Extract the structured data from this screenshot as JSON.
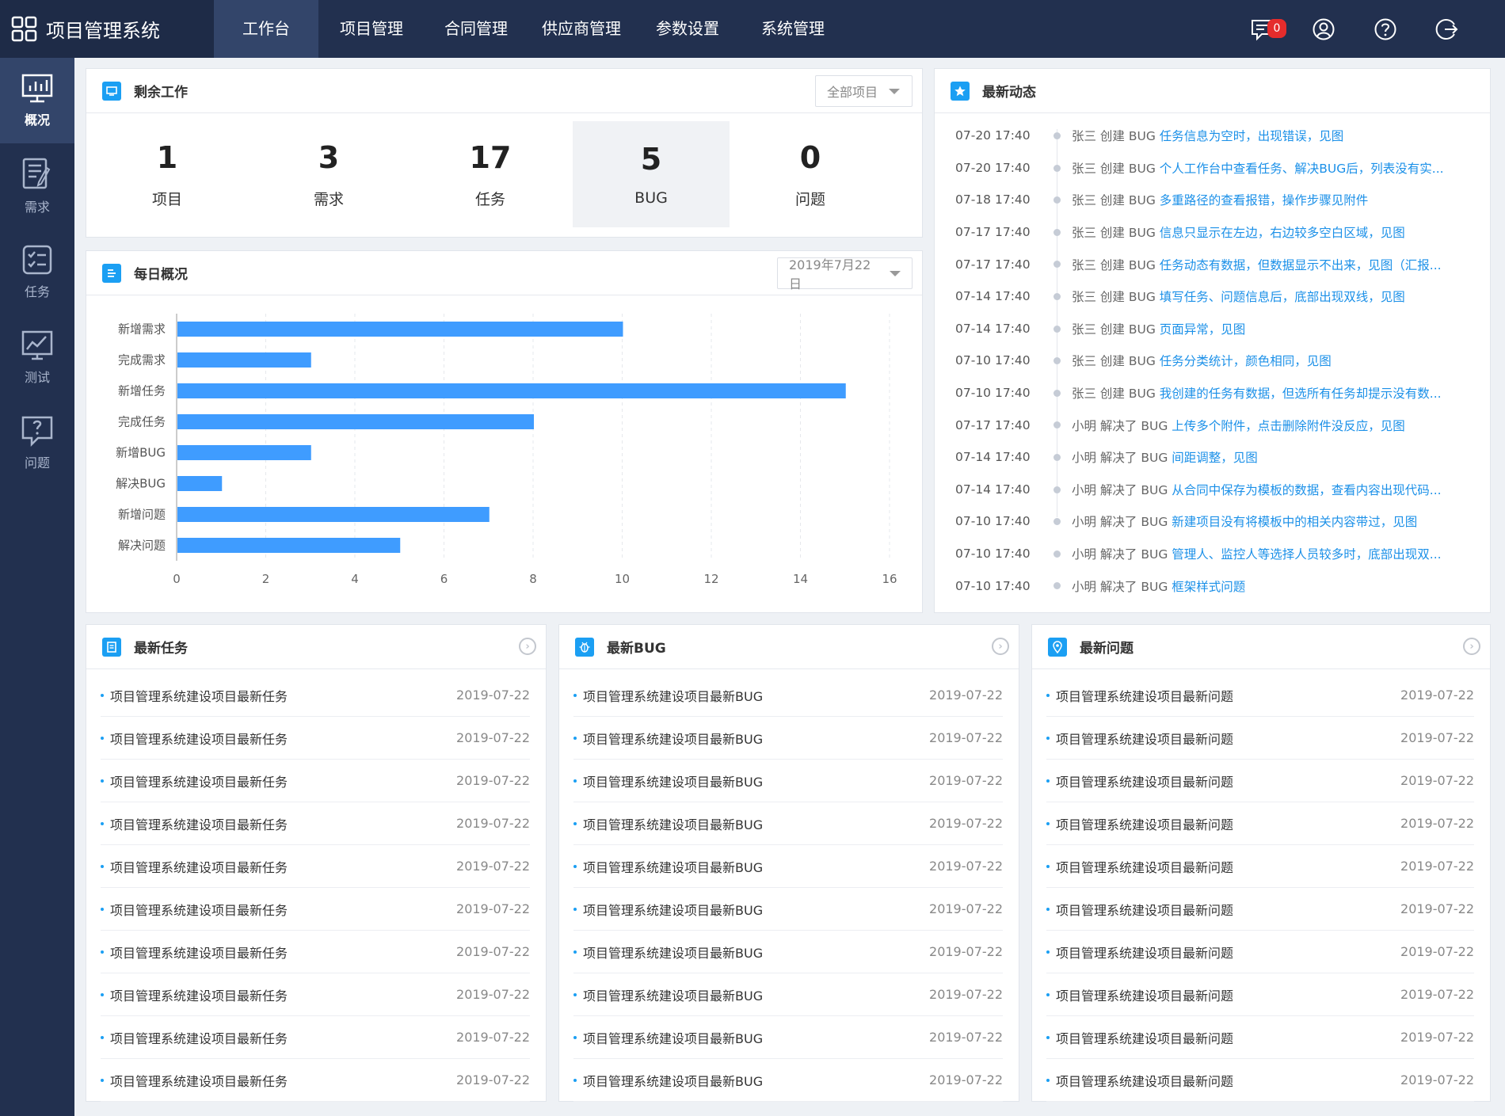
{
  "app": {
    "title": "项目管理系统"
  },
  "topnav": [
    {
      "label": "工作台",
      "active": true
    },
    {
      "label": "项目管理"
    },
    {
      "label": "合同管理"
    },
    {
      "label": "供应商管理"
    },
    {
      "label": "参数设置"
    },
    {
      "label": "系统管理"
    }
  ],
  "top_icons": {
    "message_count": "0"
  },
  "sidebar": [
    {
      "label": "概况",
      "icon": "overview-icon",
      "active": true
    },
    {
      "label": "需求",
      "icon": "requirement-icon"
    },
    {
      "label": "任务",
      "icon": "task-icon"
    },
    {
      "label": "测试",
      "icon": "test-icon"
    },
    {
      "label": "问题",
      "icon": "question-icon"
    }
  ],
  "remaining": {
    "title": "剩余工作",
    "filter": "全部项目",
    "stats": [
      {
        "num": "1",
        "label": "项目"
      },
      {
        "num": "3",
        "label": "需求"
      },
      {
        "num": "17",
        "label": "任务"
      },
      {
        "num": "5",
        "label": "BUG"
      },
      {
        "num": "0",
        "label": "问题"
      }
    ]
  },
  "daily": {
    "title": "每日概况",
    "date": "2019年7月22日"
  },
  "chart_data": {
    "type": "bar",
    "orientation": "horizontal",
    "categories": [
      "新增需求",
      "完成需求",
      "新增任务",
      "完成任务",
      "新增BUG",
      "解决BUG",
      "新增问题",
      "解决问题"
    ],
    "values": [
      10,
      3,
      15,
      8,
      3,
      1,
      7,
      5
    ],
    "xlim": [
      0,
      16
    ],
    "xticks": [
      0,
      2,
      4,
      6,
      8,
      10,
      12,
      14,
      16
    ],
    "grid": true,
    "color": "#3f9cff"
  },
  "activity": {
    "title": "最新动态",
    "items": [
      {
        "time": "07-20 17:40",
        "actor": "张三 创建 BUG",
        "text": "任务信息为空时，出现错误，见图"
      },
      {
        "time": "07-20 17:40",
        "actor": "张三 创建 BUG",
        "text": "个人工作台中查看任务、解决BUG后，列表没有实..."
      },
      {
        "time": "07-18 17:40",
        "actor": "张三 创建 BUG",
        "text": "多重路径的查看报错，操作步骤见附件"
      },
      {
        "time": "07-17 17:40",
        "actor": "张三 创建 BUG",
        "text": "信息只显示在左边，右边较多空白区域，见图"
      },
      {
        "time": "07-17 17:40",
        "actor": "张三 创建 BUG",
        "text": "任务动态有数据，但数据显示不出来，见图（汇报..."
      },
      {
        "time": "07-14 17:40",
        "actor": "张三 创建 BUG",
        "text": "填写任务、问题信息后，底部出现双线，见图"
      },
      {
        "time": "07-14 17:40",
        "actor": "张三 创建 BUG",
        "text": "页面异常，见图"
      },
      {
        "time": "07-10 17:40",
        "actor": "张三 创建 BUG",
        "text": "任务分类统计，颜色相同，见图"
      },
      {
        "time": "07-10 17:40",
        "actor": "张三 创建 BUG",
        "text": "我创建的任务有数据，但选所有任务却提示没有数..."
      },
      {
        "time": "07-17 17:40",
        "actor": "小明 解决了 BUG",
        "text": "上传多个附件，点击删除附件没反应，见图"
      },
      {
        "time": "07-14 17:40",
        "actor": "小明 解决了 BUG",
        "text": "间距调整，见图"
      },
      {
        "time": "07-14 17:40",
        "actor": "小明 解决了 BUG",
        "text": "从合同中保存为模板的数据，查看内容出现代码..."
      },
      {
        "time": "07-10 17:40",
        "actor": "小明 解决了 BUG",
        "text": "新建项目没有将模板中的相关内容带过，见图"
      },
      {
        "time": "07-10 17:40",
        "actor": "小明 解决了 BUG",
        "text": "管理人、监控人等选择人员较多时，底部出现双..."
      },
      {
        "time": "07-10 17:40",
        "actor": "小明 解决了 BUG",
        "text": "框架样式问题"
      }
    ]
  },
  "tasks": {
    "title": "最新任务",
    "items": [
      {
        "t": "项目管理系统建设项目最新任务",
        "d": "2019-07-22"
      },
      {
        "t": "项目管理系统建设项目最新任务",
        "d": "2019-07-22"
      },
      {
        "t": "项目管理系统建设项目最新任务",
        "d": "2019-07-22"
      },
      {
        "t": "项目管理系统建设项目最新任务",
        "d": "2019-07-22"
      },
      {
        "t": "项目管理系统建设项目最新任务",
        "d": "2019-07-22"
      },
      {
        "t": "项目管理系统建设项目最新任务",
        "d": "2019-07-22"
      },
      {
        "t": "项目管理系统建设项目最新任务",
        "d": "2019-07-22"
      },
      {
        "t": "项目管理系统建设项目最新任务",
        "d": "2019-07-22"
      },
      {
        "t": "项目管理系统建设项目最新任务",
        "d": "2019-07-22"
      },
      {
        "t": "项目管理系统建设项目最新任务",
        "d": "2019-07-22"
      }
    ]
  },
  "bugs": {
    "title": "最新BUG",
    "items": [
      {
        "t": "项目管理系统建设项目最新BUG",
        "d": "2019-07-22"
      },
      {
        "t": "项目管理系统建设项目最新BUG",
        "d": "2019-07-22"
      },
      {
        "t": "项目管理系统建设项目最新BUG",
        "d": "2019-07-22"
      },
      {
        "t": "项目管理系统建设项目最新BUG",
        "d": "2019-07-22"
      },
      {
        "t": "项目管理系统建设项目最新BUG",
        "d": "2019-07-22"
      },
      {
        "t": "项目管理系统建设项目最新BUG",
        "d": "2019-07-22"
      },
      {
        "t": "项目管理系统建设项目最新BUG",
        "d": "2019-07-22"
      },
      {
        "t": "项目管理系统建设项目最新BUG",
        "d": "2019-07-22"
      },
      {
        "t": "项目管理系统建设项目最新BUG",
        "d": "2019-07-22"
      },
      {
        "t": "项目管理系统建设项目最新BUG",
        "d": "2019-07-22"
      }
    ]
  },
  "issues": {
    "title": "最新问题",
    "items": [
      {
        "t": "项目管理系统建设项目最新问题",
        "d": "2019-07-22"
      },
      {
        "t": "项目管理系统建设项目最新问题",
        "d": "2019-07-22"
      },
      {
        "t": "项目管理系统建设项目最新问题",
        "d": "2019-07-22"
      },
      {
        "t": "项目管理系统建设项目最新问题",
        "d": "2019-07-22"
      },
      {
        "t": "项目管理系统建设项目最新问题",
        "d": "2019-07-22"
      },
      {
        "t": "项目管理系统建设项目最新问题",
        "d": "2019-07-22"
      },
      {
        "t": "项目管理系统建设项目最新问题",
        "d": "2019-07-22"
      },
      {
        "t": "项目管理系统建设项目最新问题",
        "d": "2019-07-22"
      },
      {
        "t": "项目管理系统建设项目最新问题",
        "d": "2019-07-22"
      },
      {
        "t": "项目管理系统建设项目最新问题",
        "d": "2019-07-22"
      }
    ]
  }
}
